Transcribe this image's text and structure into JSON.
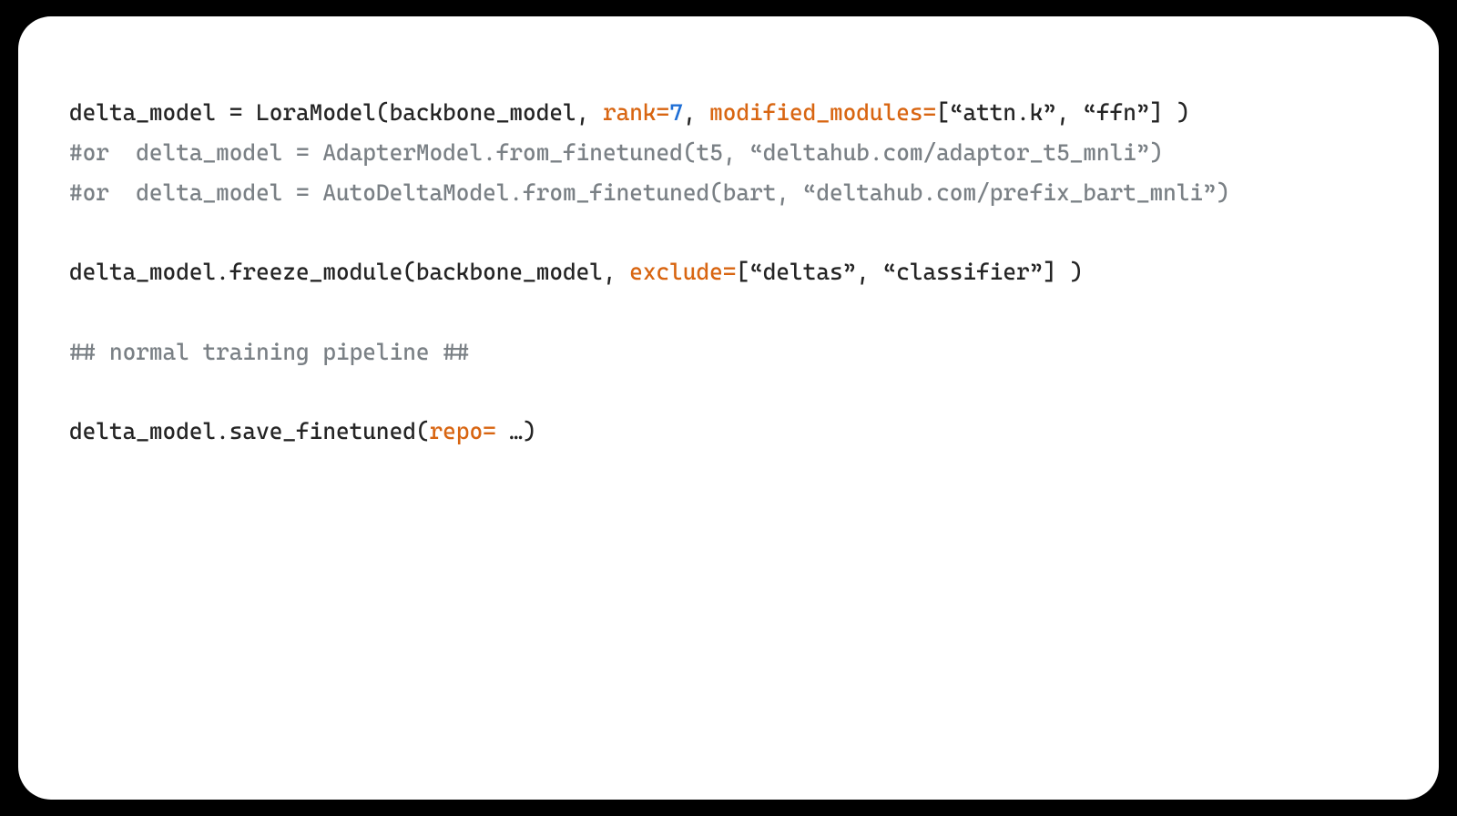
{
  "code": {
    "lines": [
      {
        "segments": [
          {
            "cls": "tok-default",
            "text": "delta_model = LoraModel(backbone_model, "
          },
          {
            "cls": "tok-keyword-arg",
            "text": "rank="
          },
          {
            "cls": "tok-number",
            "text": "7"
          },
          {
            "cls": "tok-default",
            "text": ", "
          },
          {
            "cls": "tok-keyword-arg",
            "text": "modified_modules="
          },
          {
            "cls": "tok-default",
            "text": "[“attn.k”, “ffn”] )"
          }
        ]
      },
      {
        "segments": [
          {
            "cls": "tok-comment",
            "text": "#or  delta_model = AdapterModel.from_finetuned(t5, “deltahub.com/adaptor_t5_mnli”)"
          }
        ]
      },
      {
        "segments": [
          {
            "cls": "tok-comment",
            "text": "#or  delta_model = AutoDeltaModel.from_finetuned(bart, “deltahub.com/prefix_bart_mnli”)"
          }
        ]
      },
      {
        "segments": [
          {
            "cls": "tok-default",
            "text": ""
          }
        ]
      },
      {
        "segments": [
          {
            "cls": "tok-default",
            "text": "delta_model.freeze_module(backbone_model, "
          },
          {
            "cls": "tok-keyword-arg",
            "text": "exclude="
          },
          {
            "cls": "tok-default",
            "text": "[“deltas”, “classifier”] )"
          }
        ]
      },
      {
        "segments": [
          {
            "cls": "tok-default",
            "text": ""
          }
        ]
      },
      {
        "segments": [
          {
            "cls": "tok-comment",
            "text": "## normal training pipeline ##"
          }
        ]
      },
      {
        "segments": [
          {
            "cls": "tok-default",
            "text": ""
          }
        ]
      },
      {
        "segments": [
          {
            "cls": "tok-default",
            "text": "delta_model.save_finetuned("
          },
          {
            "cls": "tok-keyword-arg",
            "text": "repo="
          },
          {
            "cls": "tok-default",
            "text": " …)"
          }
        ]
      }
    ]
  }
}
